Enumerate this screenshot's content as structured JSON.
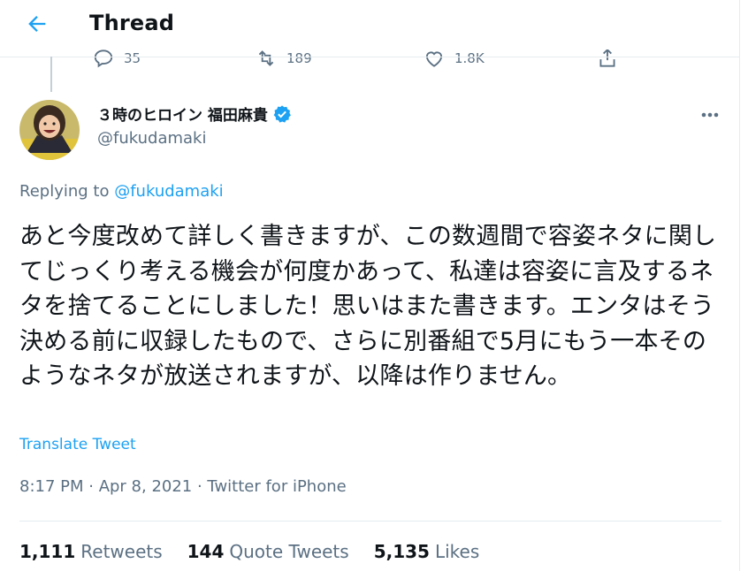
{
  "header": {
    "title": "Thread"
  },
  "previous_tweet_actions": {
    "reply_count": "35",
    "retweet_count": "189",
    "like_count": "1.8K"
  },
  "author": {
    "display_name": "３時のヒロイン 福田麻貴",
    "handle": "@fukudamaki",
    "verified": true
  },
  "tweet": {
    "replying_prefix": "Replying to ",
    "replying_to": "@fukudamaki",
    "text": "あと今度改めて詳しく書きますが、この数週間で容姿ネタに関してじっくり考える機会が何度かあって、私達は容姿に言及するネタを捨てることにしました！思いはまた書きます。エンタはそう決める前に収録したもので、さらに別番組で5月にもう一本そのようなネタが放送されますが、以降は作りません。",
    "translate_label": "Translate Tweet",
    "timestamp": "8:17 PM · Apr 8, 2021 · Twitter for iPhone"
  },
  "stats": {
    "retweets_count": "1,111",
    "retweets_label": "Retweets",
    "quote_count": "144",
    "quote_label": "Quote Tweets",
    "likes_count": "5,135",
    "likes_label": "Likes"
  },
  "colors": {
    "accent": "#1da1f2",
    "muted": "#5b7083",
    "text": "#0f1419",
    "divider": "#e6ecf0"
  }
}
